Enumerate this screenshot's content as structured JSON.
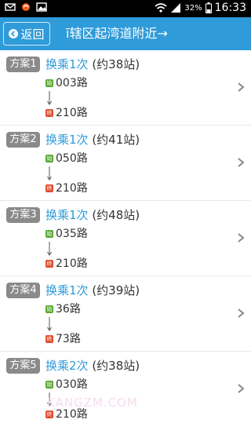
{
  "statusbar": {
    "battery": "32%",
    "time": "16:33"
  },
  "header": {
    "back_label": "返回",
    "title": "ī辖区起湾道附近→"
  },
  "plans": [
    {
      "badge": "方案1",
      "transfer_label": "换乘1次",
      "stops": "(约38站)",
      "start_route": "003路",
      "end_route": "210路",
      "start_tag": "始",
      "end_tag": "终"
    },
    {
      "badge": "方案2",
      "transfer_label": "换乘1次",
      "stops": "(约41站)",
      "start_route": "050路",
      "end_route": "210路",
      "start_tag": "始",
      "end_tag": "终"
    },
    {
      "badge": "方案3",
      "transfer_label": "换乘1次",
      "stops": "(约48站)",
      "start_route": "035路",
      "end_route": "210路",
      "start_tag": "始",
      "end_tag": "终"
    },
    {
      "badge": "方案4",
      "transfer_label": "换乘1次",
      "stops": "(约39站)",
      "start_route": "36路",
      "end_route": "73路",
      "start_tag": "始",
      "end_tag": "终"
    },
    {
      "badge": "方案5",
      "transfer_label": "换乘2次",
      "stops": "(约38站)",
      "start_route": "030路",
      "end_route": "210路",
      "start_tag": "始",
      "end_tag": "终"
    }
  ],
  "watermark": "KANGZM.COM",
  "colors": {
    "header_bg": "#2f9bd9",
    "accent": "#2f9bd9",
    "badge_bg": "#8a8a8a",
    "start_tag": "#5aa832",
    "end_tag": "#e04a2c"
  },
  "icons": [
    "email-icon",
    "app-logo-icon",
    "image-icon",
    "wifi-icon",
    "signal-icon",
    "battery-icon",
    "back-arrow-icon",
    "down-arrow-icon",
    "chevron-right-icon"
  ]
}
